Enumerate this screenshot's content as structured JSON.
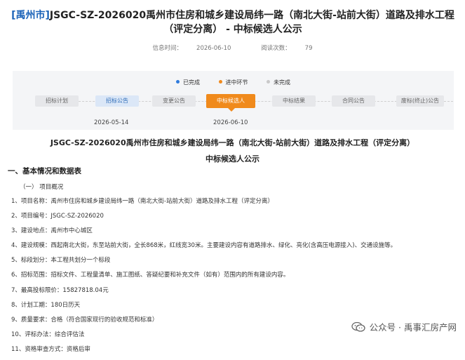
{
  "header": {
    "region_tag": "[禹州市]",
    "title": "JSGC-SZ-2026020禹州市住房和城乡建设局纬一路（南北大街-站前大街）道路及排水工程（评定分离） - 中标候选人公示"
  },
  "meta": {
    "publish_label": "信息时间：",
    "publish_time": "2026-06-10",
    "views_label": "阅读次数：",
    "views": "79"
  },
  "legend": [
    {
      "label": "已完成",
      "state": "done",
      "color": "#2f7bdd"
    },
    {
      "label": "进中环节",
      "state": "active",
      "color": "#f08a1c"
    },
    {
      "label": "未完成",
      "state": "todo",
      "color": "#c9c9c9"
    }
  ],
  "steps": [
    {
      "label": "招标计划",
      "state": "todo",
      "date": ""
    },
    {
      "label": "招标公告",
      "state": "done",
      "date": "2026-05-14"
    },
    {
      "label": "变更公告",
      "state": "todo",
      "date": ""
    },
    {
      "label": "中标候选人",
      "state": "active",
      "date": "2026-06-10"
    },
    {
      "label": "中标结果",
      "state": "todo",
      "date": ""
    },
    {
      "label": "合同公告",
      "state": "todo",
      "date": ""
    },
    {
      "label": "废标(终止)公告",
      "state": "todo",
      "date": ""
    }
  ],
  "document": {
    "title_line1": "JSGC-SZ-2026020禹州市住房和城乡建设局纬一路（南北大街-站前大街）道路及排水工程（评定分离）",
    "title_line2": "中标候选人公示",
    "section1": "一、基本情况和数据表",
    "subsection1": "（一）  项目概况",
    "items": [
      "1、项目名称：禹州市住房和城乡建设局纬一路（南北大街-站前大街）道路及排水工程（评定分离）",
      "2、项目编号：JSGC-SZ-2026020",
      "3、建设地点：禹州市中心城区",
      "4、建设规模：西起南北大街，东至站前大街，全长868米，红线宽30米。主要建设内容有道路排水、绿化、亮化(含高压电源接入)、交通设施等。",
      "5、标段划分：本工程共划分一个标段",
      "6、招标范围：招标文件、工程量清单、施工图纸、答疑纪要和补充文件（如有）范围内的所有建设内容。",
      "7、最高投标限价：15827818.04元",
      "8、计划工期：180日历天",
      "9、质量要求：合格（符合国家现行的验收规范和标准）",
      "10、评标办法：综合评估法",
      "11、资格审查方式：资格后审"
    ]
  },
  "watermark": {
    "icon": "wechat-icon",
    "text": "公众号 · 禹事汇房产网"
  }
}
